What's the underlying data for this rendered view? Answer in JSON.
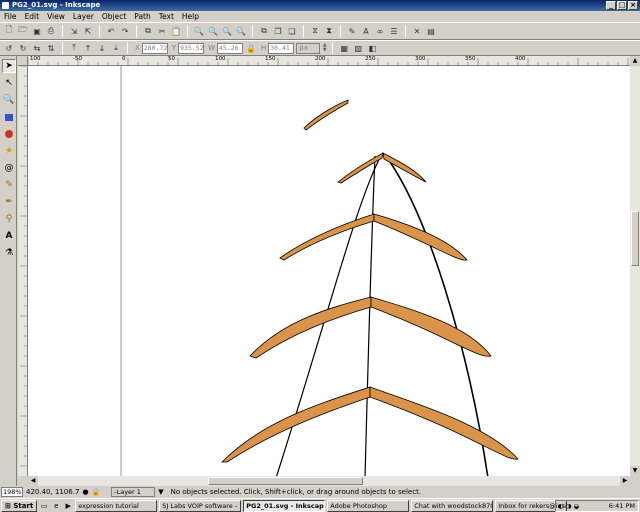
{
  "window": {
    "title": "PG2_01.svg - Inkscape"
  },
  "menu": [
    "File",
    "Edit",
    "View",
    "Layer",
    "Object",
    "Path",
    "Text",
    "Help"
  ],
  "toolbar_icons": [
    "new-icon",
    "open-icon",
    "save-icon",
    "print-icon",
    "import-icon",
    "export-icon",
    "undo-icon",
    "redo-icon",
    "copy-icon",
    "cut-icon",
    "paste-icon",
    "zoom-selection-icon",
    "zoom-drawing-icon",
    "zoom-page-icon",
    "zoom-width-icon",
    "duplicate-icon",
    "clone-icon",
    "unlink-clone-icon",
    "group-icon",
    "ungroup-icon",
    "fill-stroke-icon",
    "text-font-icon",
    "xml-editor-icon",
    "align-icon",
    "preferences-icon",
    "document-properties-icon"
  ],
  "selector": {
    "x_label": "X",
    "x_value": "280.72",
    "y_label": "Y",
    "y_value": "935.52",
    "w_label": "W",
    "w_value": "45.26",
    "h_label": "H",
    "h_value": "30.41",
    "unit": "px"
  },
  "rulers": {
    "h_labels": [
      "100",
      "-50",
      "0",
      "50",
      "100",
      "150",
      "200",
      "250",
      "300",
      "350",
      "400"
    ],
    "v_labels": [
      "1000",
      "1050",
      "1100",
      "1150",
      "1200",
      "1250",
      "1300",
      "1350",
      "1400",
      "1450",
      "1500"
    ]
  },
  "status": {
    "zoom": "198%",
    "coords": "420.40, 1106.7",
    "layer": "-Layer 1",
    "message": "No objects selected. Click, Shift+click, or drag around objects to select."
  },
  "taskbar": {
    "start": "Start",
    "tasks": [
      "expression tutorial",
      "SJ Labs VOIP software - ...",
      "PG2_01.svg - Inkscape",
      "Adobe Photoshop",
      "Chat with woodstock870...",
      "Inbox for rekers@insight...."
    ],
    "active_index": 2,
    "time": "6:41 PM"
  },
  "colors": {
    "fill": "#d9944a",
    "stroke": "#000000",
    "titlebar": "#0a246a"
  }
}
